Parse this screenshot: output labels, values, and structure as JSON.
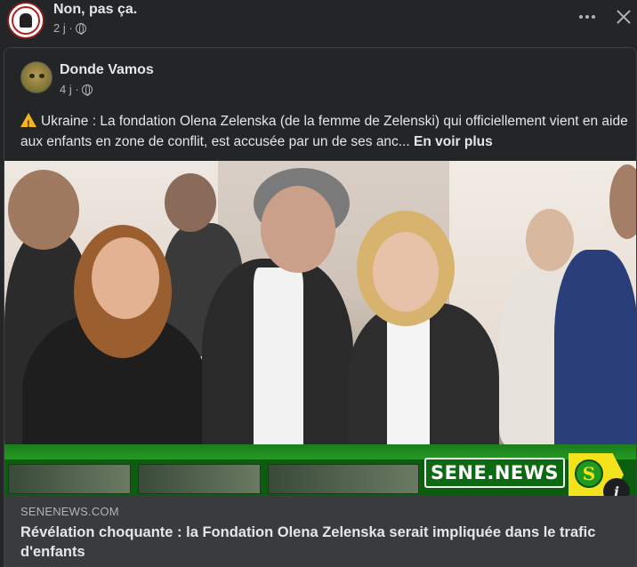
{
  "share": {
    "title": "Non, pas ça.",
    "time": "2 j ·",
    "privacy_icon": "globe-icon"
  },
  "original": {
    "author": "Donde Vamos",
    "time": "4 j ·",
    "privacy_icon": "globe-icon",
    "text": "Ukraine : La fondation Olena Zelenska (de la femme de Zelenski) qui officiellement vient en aide aux enfants en zone de conflit, est accusée par un de ses anc...",
    "see_more": "En voir plus"
  },
  "image": {
    "banner_text": "SENE.NEWS",
    "logo_letter": "S"
  },
  "link": {
    "domain": "SENENEWS.COM",
    "headline": "Révélation choquante : la Fondation Olena Zelenska serait impliquée dans le trafic d'enfants"
  },
  "colors": {
    "background": "#242526",
    "link_bar": "#3a3b3c",
    "text": "#e4e6eb",
    "secondary_text": "#b0b3b8",
    "banner_green": "#1c7d1c",
    "logo_yellow": "#f3e21c"
  }
}
